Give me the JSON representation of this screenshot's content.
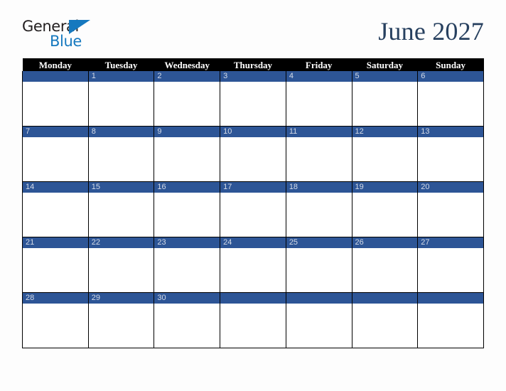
{
  "logo": {
    "word_one": "General",
    "word_two": "Blue",
    "triangle_icon": "triangle-icon",
    "primary_color": "#1679bf",
    "text_color": "#231f20"
  },
  "header": {
    "title": "June 2027",
    "title_color": "#27405f"
  },
  "calendar": {
    "month": "June",
    "year": "2027",
    "accent_color": "#2d5596",
    "header_bg": "#000000",
    "header_text_color": "#ffffff",
    "weekday_headers": [
      "Monday",
      "Tuesday",
      "Wednesday",
      "Thursday",
      "Friday",
      "Saturday",
      "Sunday"
    ],
    "weeks": [
      [
        "",
        "1",
        "2",
        "3",
        "4",
        "5",
        "6"
      ],
      [
        "7",
        "8",
        "9",
        "10",
        "11",
        "12",
        "13"
      ],
      [
        "14",
        "15",
        "16",
        "17",
        "18",
        "19",
        "20"
      ],
      [
        "21",
        "22",
        "23",
        "24",
        "25",
        "26",
        "27"
      ],
      [
        "28",
        "29",
        "30",
        "",
        "",
        "",
        ""
      ]
    ]
  }
}
